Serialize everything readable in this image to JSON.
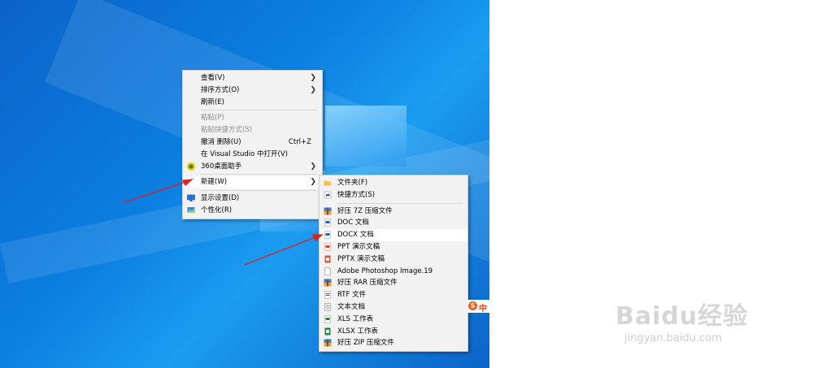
{
  "context_menu": {
    "items": [
      {
        "label": "查看(V)",
        "submenu": true
      },
      {
        "label": "排序方式(O)",
        "submenu": true
      },
      {
        "label": "刷新(E)"
      },
      {
        "label": "粘贴(P)",
        "disabled": true
      },
      {
        "label": "粘贴快捷方式(S)",
        "disabled": true
      },
      {
        "label": "撤消 删除(U)",
        "shortcut": "Ctrl+Z"
      },
      {
        "label": "在 Visual Studio 中打开(V)"
      },
      {
        "label": "360桌面助手",
        "icon": "360-icon",
        "submenu": true
      },
      {
        "label": "新建(W)",
        "submenu": true,
        "highlighted": true
      },
      {
        "label": "显示设置(D)",
        "icon": "display-settings-icon"
      },
      {
        "label": "个性化(R)",
        "icon": "personalize-icon"
      }
    ]
  },
  "new_submenu": {
    "items": [
      {
        "label": "文件夹(F)",
        "icon": "folder-icon"
      },
      {
        "label": "快捷方式(S)",
        "icon": "shortcut-icon"
      },
      {
        "label": "好压 7Z 压缩文件",
        "icon": "haozip-icon"
      },
      {
        "label": "DOC 文档",
        "icon": "doc-icon"
      },
      {
        "label": "DOCX 文档",
        "icon": "docx-icon",
        "highlighted": true
      },
      {
        "label": "PPT 演示文稿",
        "icon": "ppt-icon"
      },
      {
        "label": "PPTX 演示文稿",
        "icon": "pptx-icon"
      },
      {
        "label": "Adobe Photoshop Image.19",
        "icon": "blank-file-icon"
      },
      {
        "label": "好压 RAR 压缩文件",
        "icon": "haozip-icon"
      },
      {
        "label": "RTF 文件",
        "icon": "rtf-icon"
      },
      {
        "label": "文本文档",
        "icon": "txt-icon"
      },
      {
        "label": "XLS 工作表",
        "icon": "xls-icon"
      },
      {
        "label": "XLSX 工作表",
        "icon": "xlsx-icon"
      },
      {
        "label": "好压 ZIP 压缩文件",
        "icon": "haozip-icon"
      }
    ]
  },
  "tray": {
    "sogou_label": "中"
  },
  "watermark": {
    "brand": "Baidu经验",
    "url": "jingyan.baidu.com"
  },
  "colors": {
    "annotation_arrow": "#e02020",
    "desktop": "#0b7ee0",
    "menu_bg": "#f2f2f2"
  }
}
